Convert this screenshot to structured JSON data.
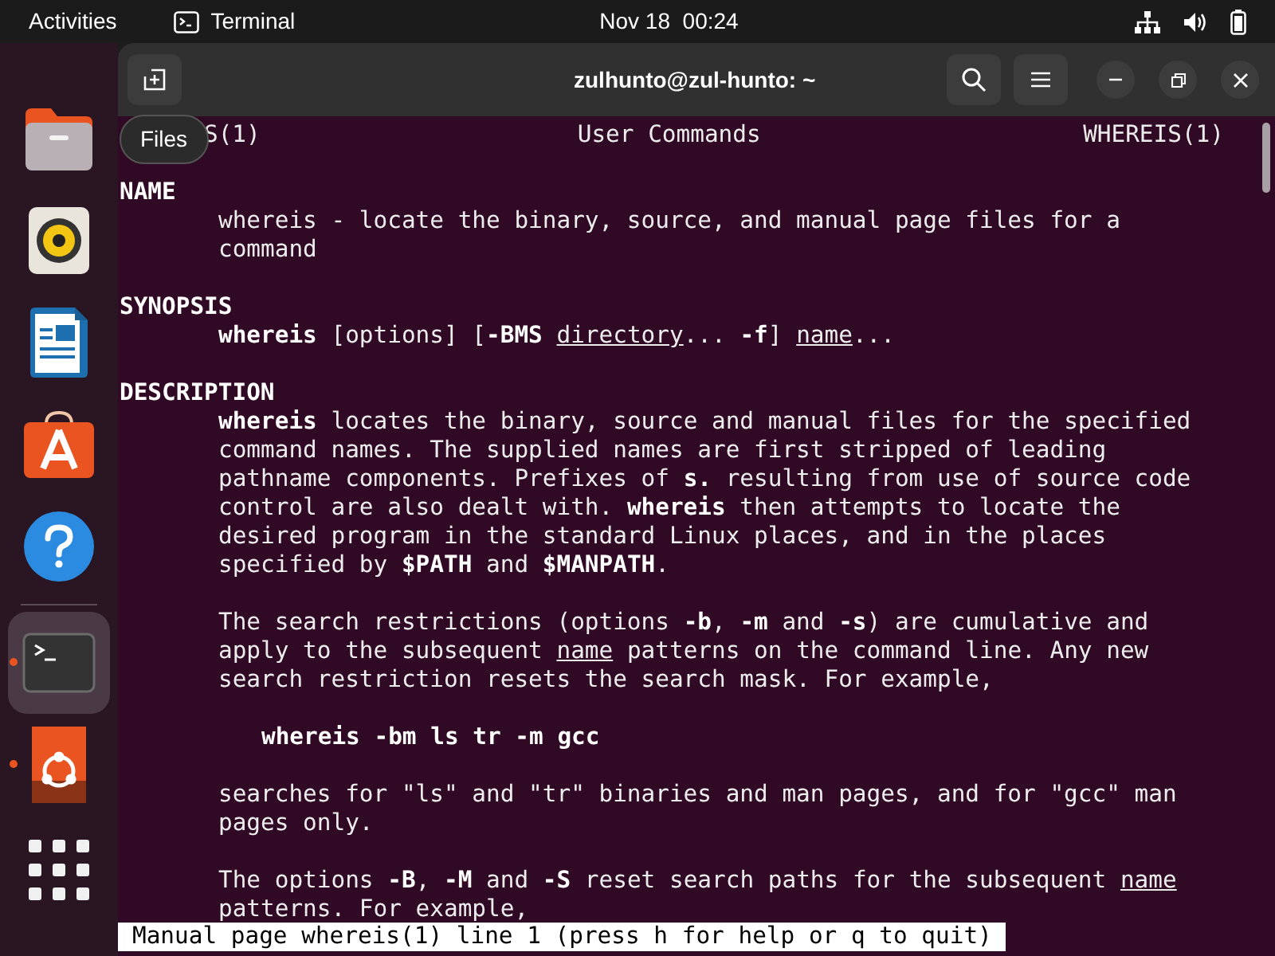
{
  "top_bar": {
    "activities": "Activities",
    "app_name": "Terminal",
    "clock": "Nov 18  00:24"
  },
  "dock": {
    "items": [
      {
        "kind": "files",
        "selected": false,
        "running": false
      },
      {
        "kind": "music",
        "selected": false,
        "running": false
      },
      {
        "kind": "writer",
        "selected": false,
        "running": false
      },
      {
        "kind": "store",
        "selected": false,
        "running": false
      },
      {
        "kind": "help",
        "selected": false,
        "running": false
      },
      {
        "kind": "terminal",
        "selected": true,
        "running": true
      },
      {
        "kind": "ubuntu",
        "selected": false,
        "running": true
      }
    ],
    "tooltip": "Files"
  },
  "window": {
    "title": "zulhunto@zul-hunto: ~"
  },
  "man": {
    "header": {
      "left": "S(1)",
      "center": "User Commands",
      "right": "WHEREIS(1)"
    },
    "sections": [
      {
        "heading": "NAME",
        "paragraphs": [
          {
            "kind": "body",
            "lines": [
              "whereis - locate the binary, source, and manual page files for a",
              "command"
            ]
          }
        ]
      },
      {
        "heading": "SYNOPSIS",
        "paragraphs": [
          {
            "kind": "body",
            "lines": [
              "**whereis** [options] [**-BMS** *directory*... **-f**] *name*..."
            ]
          }
        ]
      },
      {
        "heading": "DESCRIPTION",
        "paragraphs": [
          {
            "kind": "body",
            "lines": [
              "**whereis** locates the binary, source and manual files for the specified",
              "command names. The supplied names are first stripped of leading",
              "pathname components. Prefixes of **s.** resulting from use of source code",
              "control are also dealt with. **whereis** then attempts to locate the",
              "desired program in the standard Linux places, and in the places",
              "specified by **$PATH** and **$MANPATH**."
            ]
          },
          {
            "kind": "body",
            "lines": [
              "The search restrictions (options **-b**, **-m** and **-s**) are cumulative and",
              "apply to the subsequent *name* patterns on the command line. Any new",
              "search restriction resets the search mask. For example,"
            ]
          },
          {
            "kind": "example",
            "lines": [
              "whereis -bm ls tr -m gcc"
            ]
          },
          {
            "kind": "body",
            "lines": [
              "searches for \"ls\" and \"tr\" binaries and man pages, and for \"gcc\" man",
              "pages only."
            ]
          },
          {
            "kind": "body",
            "lines": [
              "The options **-B**, **-M** and **-S** reset search paths for the subsequent *name*",
              "patterns. For example,"
            ]
          }
        ]
      }
    ],
    "status_line": "Manual page whereis(1) line 1 (press h for help or q to quit)"
  }
}
